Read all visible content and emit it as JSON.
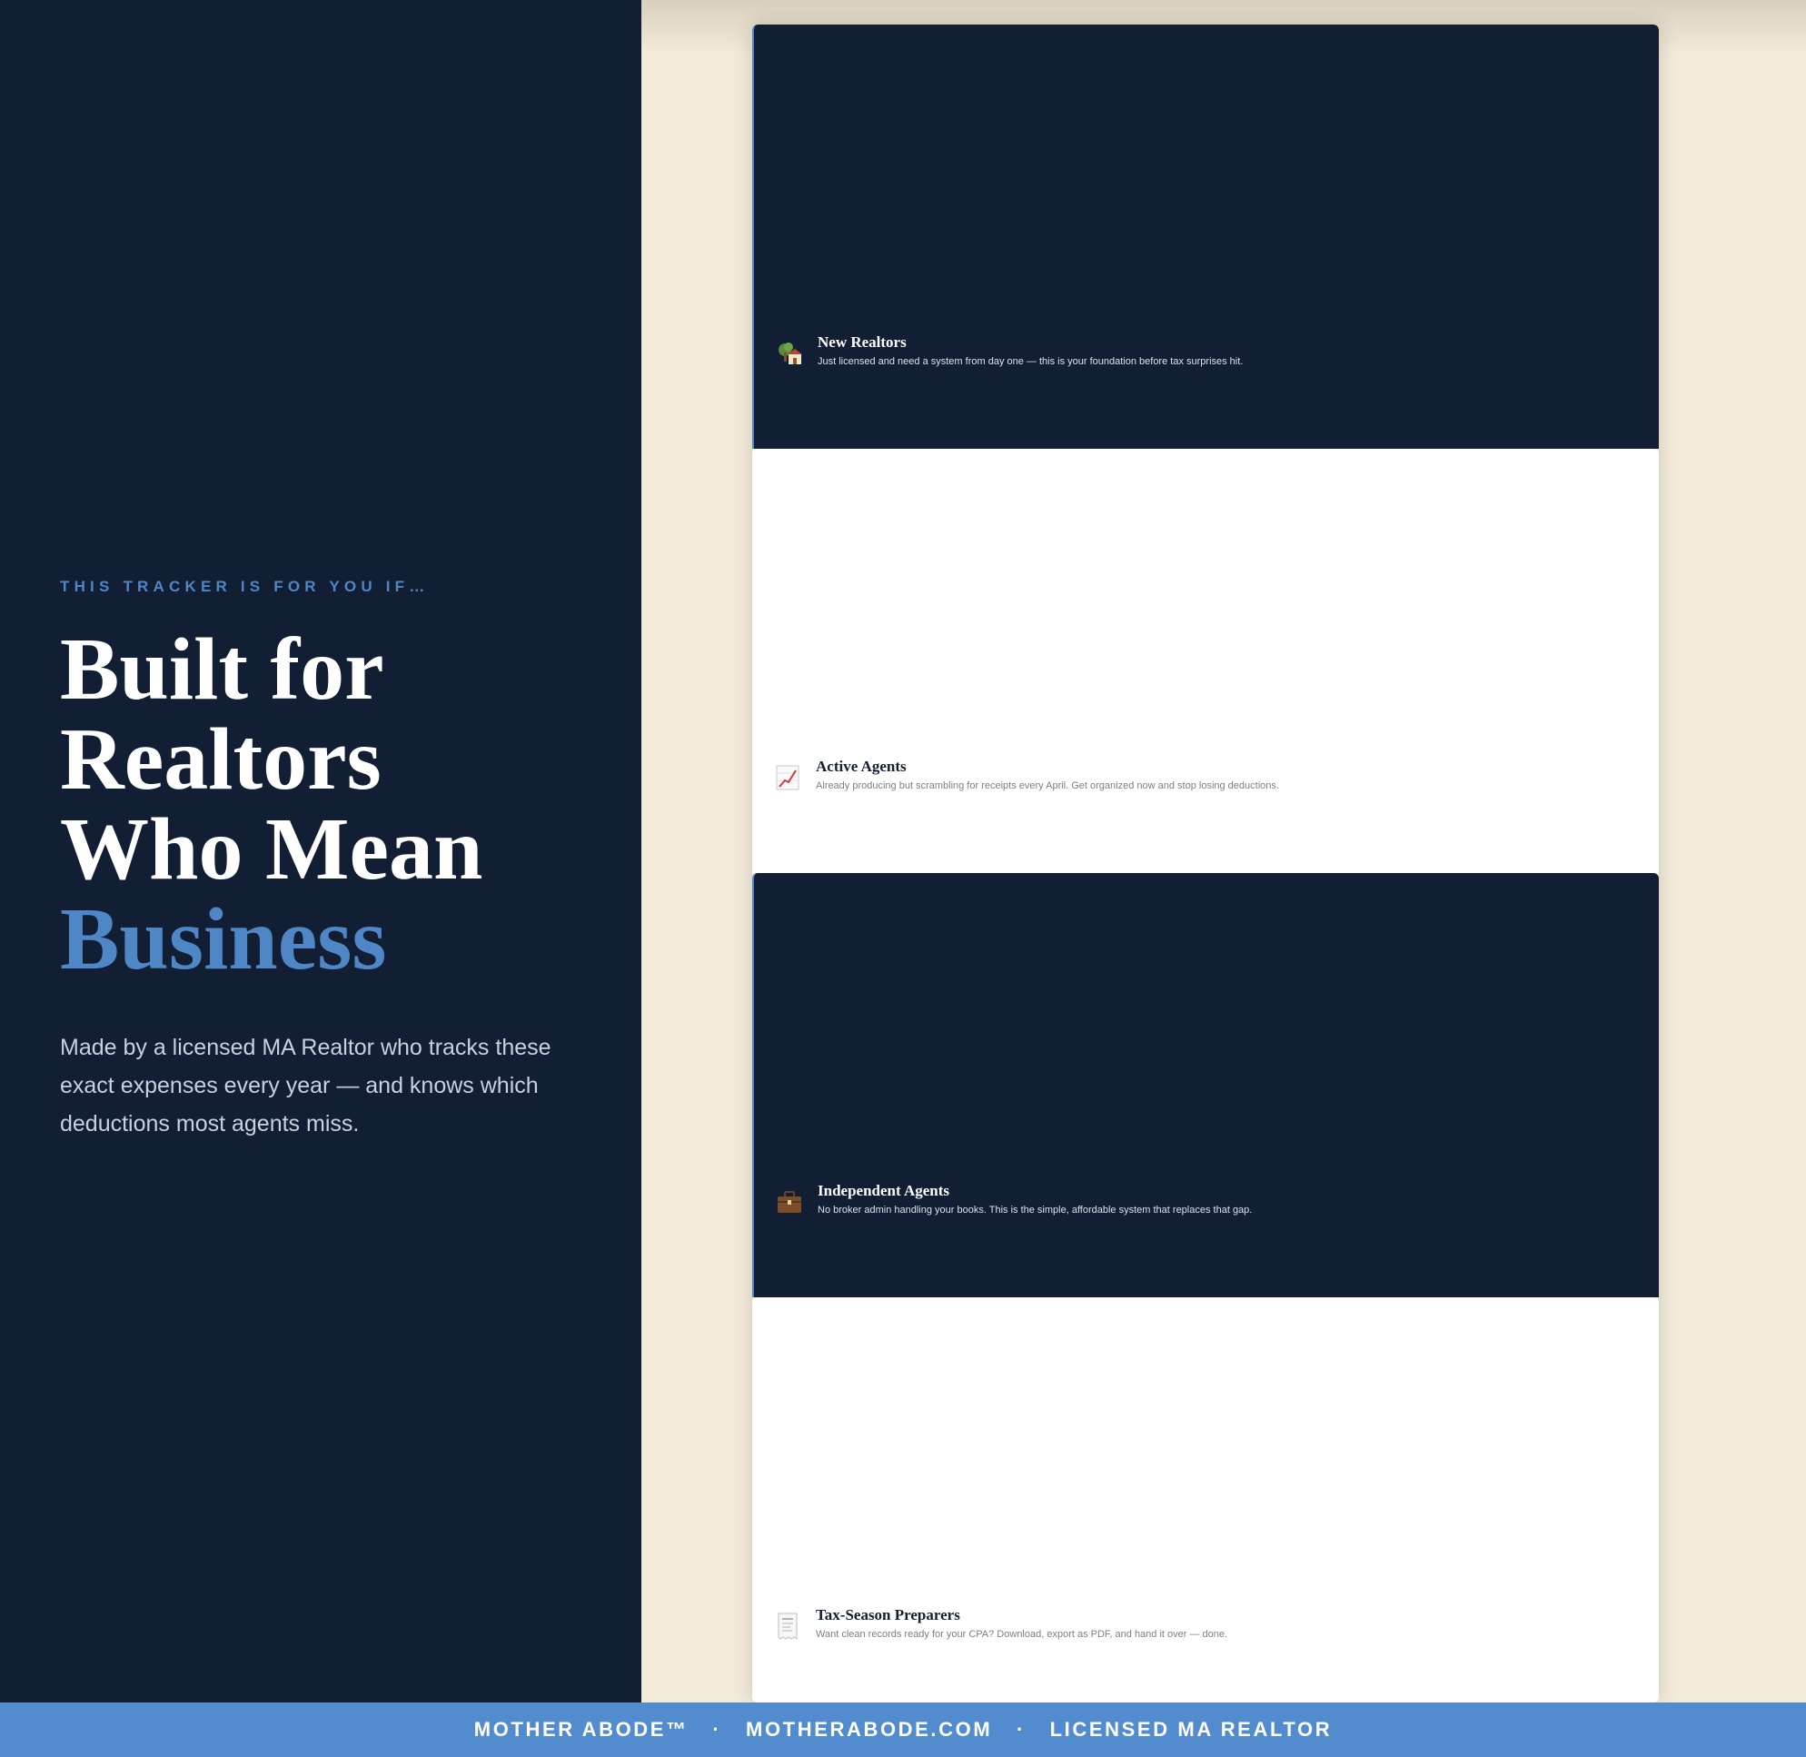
{
  "left": {
    "eyebrow": "THIS TRACKER IS FOR YOU IF…",
    "headline": {
      "line1": "Built for",
      "line2": "Realtors",
      "line3": "Who Mean",
      "accent": "Business"
    },
    "lede": "Made by a licensed MA Realtor who tracks these exact expenses every year — and knows which deductions most agents miss."
  },
  "cards": [
    {
      "icon": "house-tree-icon",
      "title": "New Realtors",
      "desc": "Just licensed and need a system from day one — this is your foundation before tax surprises hit.",
      "theme": "dark"
    },
    {
      "icon": "chart-up-icon",
      "title": "Active Agents",
      "desc": "Already producing but scrambling for receipts every April. Get organized now and stop losing deductions.",
      "theme": "light"
    },
    {
      "icon": "briefcase-icon",
      "title": "Independent Agents",
      "desc": "No broker admin handling your books. This is the simple, affordable system that replaces that gap.",
      "theme": "dark"
    },
    {
      "icon": "receipt-icon",
      "title": "Tax-Season Preparers",
      "desc": "Want clean records ready for your CPA? Download, export as PDF, and hand it over — done.",
      "theme": "light"
    }
  ],
  "footer": {
    "brand": "MOTHER ABODE™",
    "sep": "·",
    "site": "MOTHERABODE.COM",
    "tag": "LICENSED MA REALTOR"
  },
  "colors": {
    "navy": "#121e33",
    "accent": "#4f86c6",
    "cream": "#f3ebda",
    "footer": "#538cce"
  }
}
